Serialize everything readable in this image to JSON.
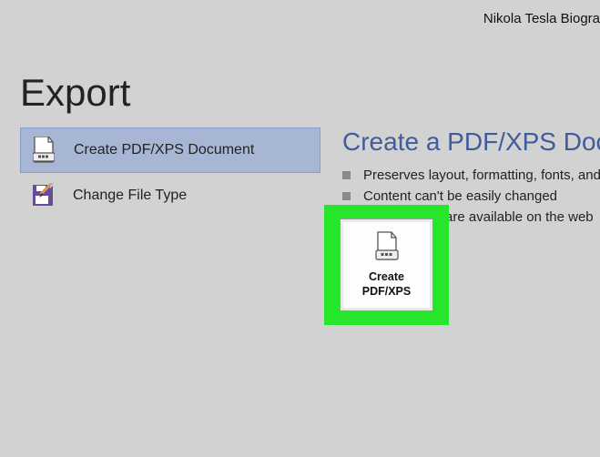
{
  "document_title": "Nikola Tesla Biogra",
  "page_title": "Export",
  "left_options": [
    {
      "label": "Create PDF/XPS Document"
    },
    {
      "label": "Change File Type"
    }
  ],
  "right": {
    "title": "Create a PDF/XPS Documen",
    "bullets": [
      "Preserves layout, formatting, fonts, and ima",
      "Content can't be easily changed",
      "Free viewers are available on the web"
    ],
    "button_label": "Create PDF/XPS"
  }
}
